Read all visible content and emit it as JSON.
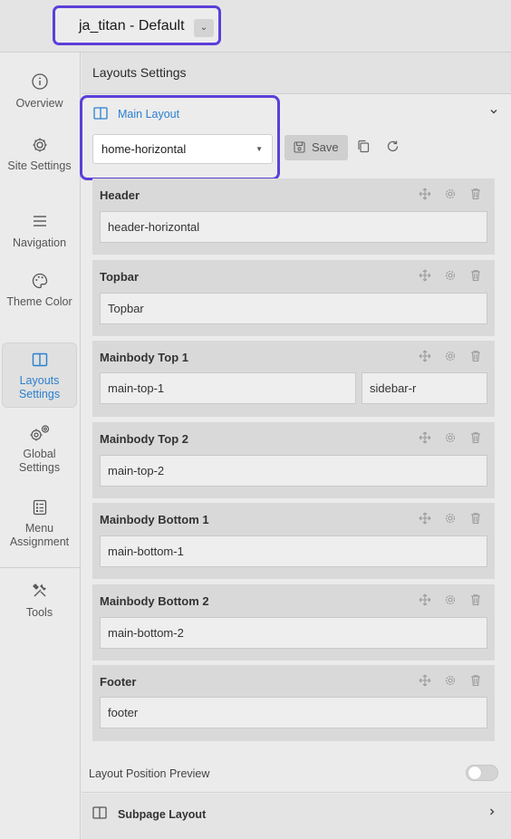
{
  "header": {
    "template_name": "ja_titan - Default",
    "template_caret": "⌄"
  },
  "sidebar": {
    "items": [
      {
        "label": "Overview",
        "icon": "info-icon"
      },
      {
        "label": "Site Settings",
        "icon": "gear-icon"
      },
      {
        "label": "Navigation",
        "icon": "menu-lines-icon"
      },
      {
        "label": "Theme Color",
        "icon": "palette-icon"
      },
      {
        "label": "Layouts Settings",
        "icon": "layout-columns-icon",
        "active": true
      },
      {
        "label": "Global Settings",
        "icon": "gears-icon"
      },
      {
        "label": "Menu Assignment",
        "icon": "list-doc-icon"
      },
      {
        "label": "Tools",
        "icon": "tools-icon"
      }
    ]
  },
  "main": {
    "title": "Layouts Settings",
    "main_layout": {
      "label": "Main Layout",
      "selected": "home-horizontal",
      "collapse_icon": "chevron-down-icon"
    },
    "toolbar": {
      "save_label": "Save"
    },
    "sections": [
      {
        "title": "Header",
        "positions": [
          "header-horizontal"
        ]
      },
      {
        "title": "Topbar",
        "positions": [
          "Topbar"
        ]
      },
      {
        "title": "Mainbody Top 1",
        "positions": [
          "main-top-1",
          "sidebar-r"
        ]
      },
      {
        "title": "Mainbody Top 2",
        "positions": [
          "main-top-2"
        ]
      },
      {
        "title": "Mainbody Bottom 1",
        "positions": [
          "main-bottom-1"
        ]
      },
      {
        "title": "Mainbody Bottom 2",
        "positions": [
          "main-bottom-2"
        ]
      },
      {
        "title": "Footer",
        "positions": [
          "footer"
        ]
      }
    ],
    "preview": {
      "label": "Layout Position Preview",
      "enabled": false
    },
    "subpage": {
      "label": "Subpage Layout"
    }
  },
  "colors": {
    "accent": "#2b7fd0",
    "highlight": "#5b3fd9"
  }
}
